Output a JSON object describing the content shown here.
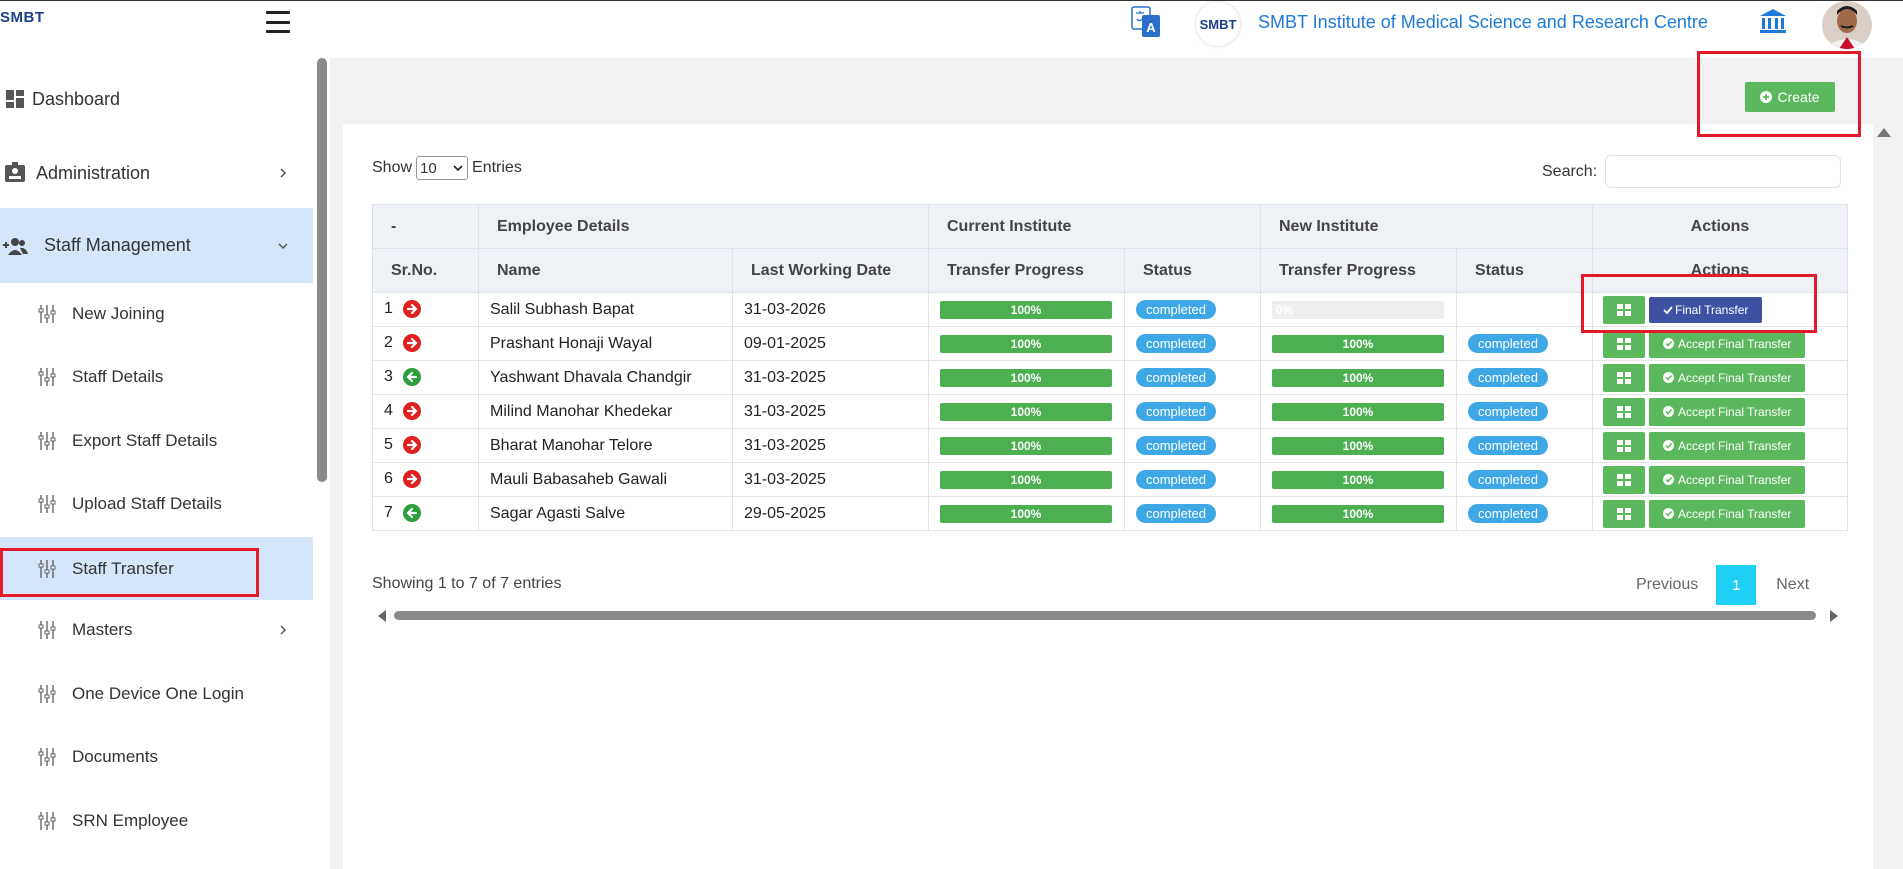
{
  "header": {
    "brand": "SMBT",
    "badge_text": "SMBT",
    "institute_name": "SMBT Institute of Medical Science and Research Centre"
  },
  "sidebar": {
    "items": [
      {
        "label": "Dashboard",
        "icon": "dashboard-icon"
      },
      {
        "label": "Administration",
        "icon": "id-card-icon"
      },
      {
        "label": "Staff Management",
        "icon": "user-plus-icon"
      },
      {
        "label": "New Joining",
        "icon": "sliders-icon"
      },
      {
        "label": "Staff Details",
        "icon": "sliders-icon"
      },
      {
        "label": "Export Staff Details",
        "icon": "sliders-icon"
      },
      {
        "label": "Upload Staff Details",
        "icon": "sliders-icon"
      },
      {
        "label": "Staff Transfer",
        "icon": "sliders-icon"
      },
      {
        "label": "Masters",
        "icon": "sliders-icon"
      },
      {
        "label": "One Device One Login",
        "icon": "sliders-icon"
      },
      {
        "label": "Documents",
        "icon": "sliders-icon"
      },
      {
        "label": "SRN Employee",
        "icon": "sliders-icon"
      }
    ]
  },
  "toolbar": {
    "create_label": "Create"
  },
  "table_controls": {
    "show_label": "Show",
    "entries_value": "10",
    "entries_label": "Entries",
    "search_label": "Search:"
  },
  "table": {
    "group_headers": [
      "-",
      "Employee Details",
      "Current Institute",
      "New Institute",
      "Actions"
    ],
    "columns": [
      "Sr.No.",
      "Name",
      "Last Working Date",
      "Transfer Progress",
      "Status",
      "Transfer Progress",
      "Status",
      "Actions"
    ],
    "rows": [
      {
        "sr": "1",
        "direction": "out",
        "name": "Salil Subhash Bapat",
        "date": "31-03-2026",
        "cur_progress": 100,
        "cur_progress_label": "100%",
        "cur_status": "completed",
        "new_progress": 0,
        "new_progress_label": "0%",
        "new_status": "",
        "action": "Final Transfer"
      },
      {
        "sr": "2",
        "direction": "out",
        "name": "Prashant Honaji Wayal",
        "date": "09-01-2025",
        "cur_progress": 100,
        "cur_progress_label": "100%",
        "cur_status": "completed",
        "new_progress": 100,
        "new_progress_label": "100%",
        "new_status": "completed",
        "action": "Accept Final Transfer"
      },
      {
        "sr": "3",
        "direction": "in",
        "name": "Yashwant Dhavala Chandgir",
        "date": "31-03-2025",
        "cur_progress": 100,
        "cur_progress_label": "100%",
        "cur_status": "completed",
        "new_progress": 100,
        "new_progress_label": "100%",
        "new_status": "completed",
        "action": "Accept Final Transfer"
      },
      {
        "sr": "4",
        "direction": "out",
        "name": "Milind Manohar Khedekar",
        "date": "31-03-2025",
        "cur_progress": 100,
        "cur_progress_label": "100%",
        "cur_status": "completed",
        "new_progress": 100,
        "new_progress_label": "100%",
        "new_status": "completed",
        "action": "Accept Final Transfer"
      },
      {
        "sr": "5",
        "direction": "out",
        "name": "Bharat Manohar Telore",
        "date": "31-03-2025",
        "cur_progress": 100,
        "cur_progress_label": "100%",
        "cur_status": "completed",
        "new_progress": 100,
        "new_progress_label": "100%",
        "new_status": "completed",
        "action": "Accept Final Transfer"
      },
      {
        "sr": "6",
        "direction": "out",
        "name": "Mauli Babasaheb Gawali",
        "date": "31-03-2025",
        "cur_progress": 100,
        "cur_progress_label": "100%",
        "cur_status": "completed",
        "new_progress": 100,
        "new_progress_label": "100%",
        "new_status": "completed",
        "action": "Accept Final Transfer"
      },
      {
        "sr": "7",
        "direction": "in",
        "name": "Sagar Agasti Salve",
        "date": "29-05-2025",
        "cur_progress": 100,
        "cur_progress_label": "100%",
        "cur_status": "completed",
        "new_progress": 100,
        "new_progress_label": "100%",
        "new_status": "completed",
        "action": "Accept Final Transfer"
      }
    ]
  },
  "footer": {
    "info": "Showing 1 to 7 of 7 entries",
    "previous": "Previous",
    "page": "1",
    "next": "Next"
  },
  "colors": {
    "accent_blue": "#1e7ad8",
    "success_green": "#5cb85c",
    "progress_green": "#4caf50",
    "badge_blue": "#3ea8e6",
    "final_button": "#3f51a3",
    "active_nav": "#d5e6fb",
    "highlight_red": "#e21a2a",
    "arrow_out": "#e02020",
    "arrow_in": "#2e9e3c",
    "pager_active": "#1fd0f5"
  }
}
